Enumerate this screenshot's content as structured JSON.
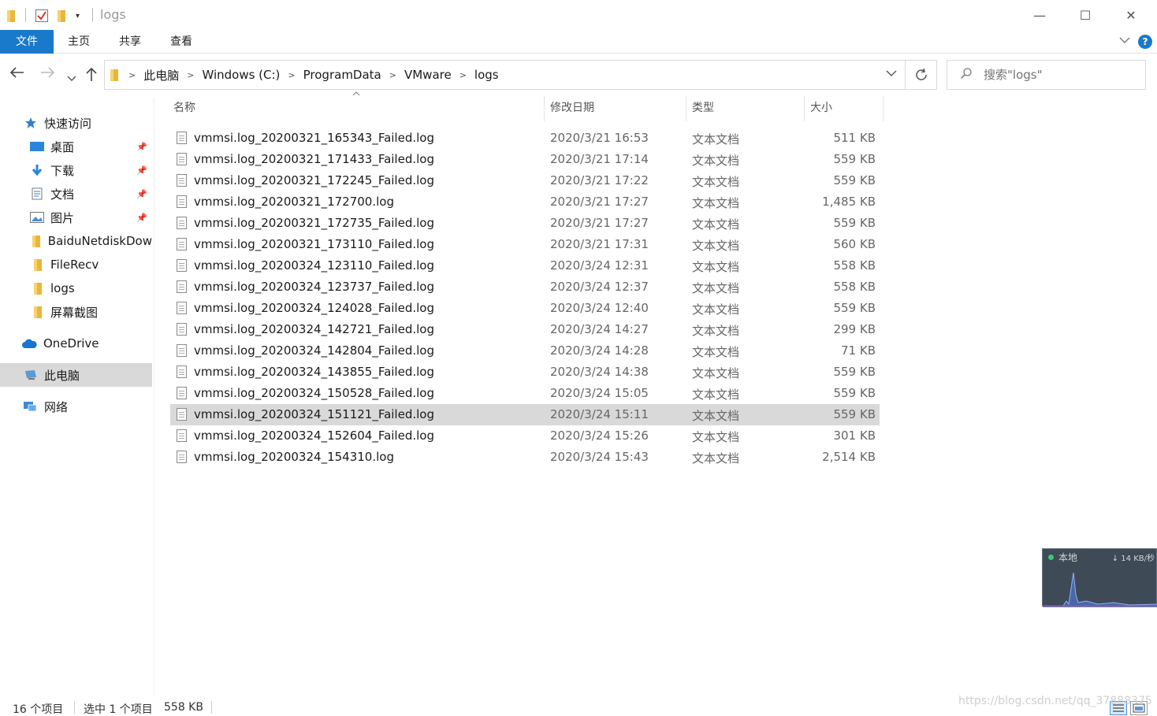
{
  "window": {
    "title": "logs",
    "minimize_glyph": "—",
    "maximize_glyph": "☐",
    "close_glyph": "✕"
  },
  "ribbon": {
    "tabs": [
      "文件",
      "主页",
      "共享",
      "查看"
    ],
    "help": "?"
  },
  "address": {
    "segments": [
      "此电脑",
      "Windows (C:)",
      "ProgramData",
      "VMware",
      "logs"
    ]
  },
  "search": {
    "placeholder": "搜索\"logs\""
  },
  "navpane": {
    "items": [
      {
        "label": "快速访问",
        "icon": "star-icon"
      },
      {
        "label": "桌面",
        "icon": "desktop-icon",
        "pinned": true
      },
      {
        "label": "下载",
        "icon": "download-icon",
        "pinned": true
      },
      {
        "label": "文档",
        "icon": "document-icon",
        "pinned": true
      },
      {
        "label": "图片",
        "icon": "picture-icon",
        "pinned": true
      },
      {
        "label": "BaiduNetdiskDow",
        "icon": "folder-icon"
      },
      {
        "label": "FileRecv",
        "icon": "folder-icon"
      },
      {
        "label": "logs",
        "icon": "folder-icon"
      },
      {
        "label": "屏幕截图",
        "icon": "folder-icon"
      },
      {
        "label": "OneDrive",
        "icon": "cloud-icon"
      },
      {
        "label": "此电脑",
        "icon": "computer-icon",
        "selected": true
      },
      {
        "label": "网络",
        "icon": "network-icon"
      }
    ]
  },
  "columns": {
    "name": "名称",
    "date": "修改日期",
    "type": "类型",
    "size": "大小"
  },
  "files": [
    {
      "name": "vmmsi.log_20200321_165343_Failed.log",
      "date": "2020/3/21 16:53",
      "type": "文本文档",
      "size": "511 KB"
    },
    {
      "name": "vmmsi.log_20200321_171433_Failed.log",
      "date": "2020/3/21 17:14",
      "type": "文本文档",
      "size": "559 KB"
    },
    {
      "name": "vmmsi.log_20200321_172245_Failed.log",
      "date": "2020/3/21 17:22",
      "type": "文本文档",
      "size": "559 KB"
    },
    {
      "name": "vmmsi.log_20200321_172700.log",
      "date": "2020/3/21 17:27",
      "type": "文本文档",
      "size": "1,485 KB"
    },
    {
      "name": "vmmsi.log_20200321_172735_Failed.log",
      "date": "2020/3/21 17:27",
      "type": "文本文档",
      "size": "559 KB"
    },
    {
      "name": "vmmsi.log_20200321_173110_Failed.log",
      "date": "2020/3/21 17:31",
      "type": "文本文档",
      "size": "560 KB"
    },
    {
      "name": "vmmsi.log_20200324_123110_Failed.log",
      "date": "2020/3/24 12:31",
      "type": "文本文档",
      "size": "558 KB"
    },
    {
      "name": "vmmsi.log_20200324_123737_Failed.log",
      "date": "2020/3/24 12:37",
      "type": "文本文档",
      "size": "558 KB"
    },
    {
      "name": "vmmsi.log_20200324_124028_Failed.log",
      "date": "2020/3/24 12:40",
      "type": "文本文档",
      "size": "559 KB"
    },
    {
      "name": "vmmsi.log_20200324_142721_Failed.log",
      "date": "2020/3/24 14:27",
      "type": "文本文档",
      "size": "299 KB"
    },
    {
      "name": "vmmsi.log_20200324_142804_Failed.log",
      "date": "2020/3/24 14:28",
      "type": "文本文档",
      "size": "71 KB"
    },
    {
      "name": "vmmsi.log_20200324_143855_Failed.log",
      "date": "2020/3/24 14:38",
      "type": "文本文档",
      "size": "559 KB"
    },
    {
      "name": "vmmsi.log_20200324_150528_Failed.log",
      "date": "2020/3/24 15:05",
      "type": "文本文档",
      "size": "559 KB"
    },
    {
      "name": "vmmsi.log_20200324_151121_Failed.log",
      "date": "2020/3/24 15:11",
      "type": "文本文档",
      "size": "559 KB",
      "selected": true
    },
    {
      "name": "vmmsi.log_20200324_152604_Failed.log",
      "date": "2020/3/24 15:26",
      "type": "文本文档",
      "size": "301 KB"
    },
    {
      "name": "vmmsi.log_20200324_154310.log",
      "date": "2020/3/24 15:43",
      "type": "文本文档",
      "size": "2,514 KB"
    }
  ],
  "status": {
    "count": "16 个项目",
    "selection": "选中 1 个项目",
    "selection_size": "558 KB"
  },
  "net_widget": {
    "label": "本地",
    "speed": "↓ 14 KB/秒"
  },
  "watermark": "https://blog.csdn.net/qq_37888375",
  "colors": {
    "accent": "#1979ca",
    "selection": "#d9d9d9",
    "folder": "#f2c94c"
  }
}
